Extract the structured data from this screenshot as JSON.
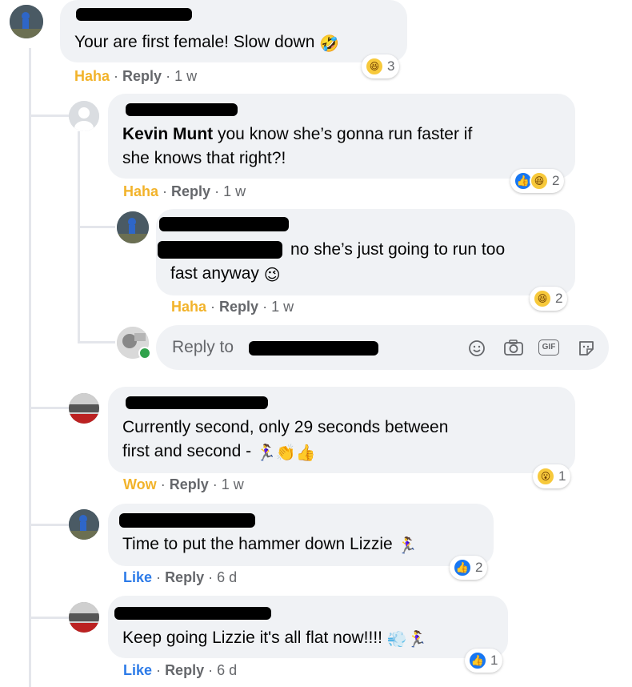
{
  "comments": [
    {
      "text": "Your are first female! Slow down",
      "reaction_label": "Haha",
      "reply_label": "Reply",
      "time": "1 w",
      "reaction_count": "3",
      "reaction_types": [
        "haha-icon"
      ]
    },
    {
      "mention": "Kevin Munt",
      "text_line1": " you know she’s gonna run faster if",
      "text_line2": "she knows that right?!",
      "reaction_label": "Haha",
      "reply_label": "Reply",
      "time": "1 w",
      "reaction_count": "2",
      "reaction_types": [
        "like-icon",
        "haha-icon"
      ]
    },
    {
      "text_line1": "no she’s just going to run too",
      "text_line2": "fast anyway",
      "reaction_label": "Haha",
      "reply_label": "Reply",
      "time": "1 w",
      "reaction_count": "2",
      "reaction_types": [
        "haha-icon"
      ]
    },
    {
      "text_line1": "Currently second, only 29 seconds between",
      "text_line2": "first and second -",
      "reaction_label": "Wow",
      "reply_label": "Reply",
      "time": "1 w",
      "reaction_count": "1",
      "reaction_types": [
        "wow-icon"
      ]
    },
    {
      "text": "Time to put the hammer down Lizzie",
      "reaction_label": "Like",
      "reply_label": "Reply",
      "time": "6 d",
      "reaction_count": "2",
      "reaction_types": [
        "like-icon"
      ]
    },
    {
      "text": "Keep going Lizzie it's all flat now!!!!",
      "reaction_label": "Like",
      "reply_label": "Reply",
      "time": "6 d",
      "reaction_count": "1",
      "reaction_types": [
        "like-icon"
      ]
    }
  ],
  "reply_box": {
    "placeholder": "Reply to",
    "tools": [
      "emoji-icon",
      "camera-icon",
      "gif-icon",
      "sticker-icon"
    ],
    "gif_label": "GIF"
  },
  "separator": "·",
  "colors": {
    "bubble": "#f0f2f5",
    "haha": "#f2b32b",
    "like": "#2d7be8",
    "meta": "#65676b",
    "thread_line": "#e4e6eb"
  }
}
